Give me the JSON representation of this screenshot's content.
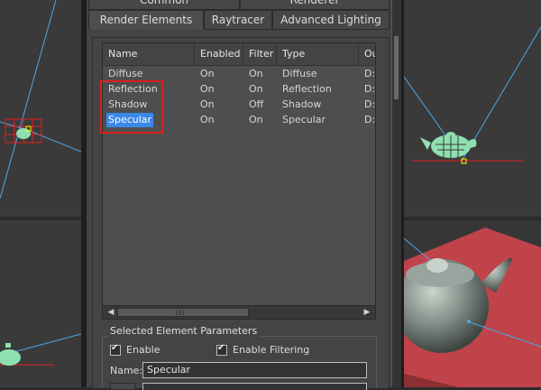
{
  "tabs_top": [
    "Common",
    "Renderer"
  ],
  "tabs": [
    "Render Elements",
    "Raytracer",
    "Advanced Lighting"
  ],
  "list": {
    "columns": [
      "Name",
      "Enabled",
      "Filter",
      "Type",
      "Ou"
    ],
    "rows": [
      {
        "name": "Diffuse",
        "enabled": "On",
        "filter": "On",
        "type": "Diffuse",
        "output": "D:\\"
      },
      {
        "name": "Reflection",
        "enabled": "On",
        "filter": "On",
        "type": "Reflection",
        "output": "D:\\"
      },
      {
        "name": "Shadow",
        "enabled": "On",
        "filter": "Off",
        "type": "Shadow",
        "output": "D:\\"
      },
      {
        "name": "Specular",
        "enabled": "On",
        "filter": "On",
        "type": "Specular",
        "output": "D:\\"
      }
    ],
    "selected": "Specular",
    "scroll_left_icon": "scroll-left-arrow",
    "scroll_right_icon": "scroll-right-arrow",
    "grip": "III"
  },
  "params": {
    "title": "Selected Element Parameters",
    "enable_label": "Enable",
    "enable_filtering_label": "Enable Filtering",
    "name_label": "Name:",
    "name_value": "Specular"
  },
  "colors": {
    "selection": "#3a88e8",
    "highlight": "#d92020",
    "teapot": "#8fe0b0",
    "floor": "#c0434a"
  }
}
